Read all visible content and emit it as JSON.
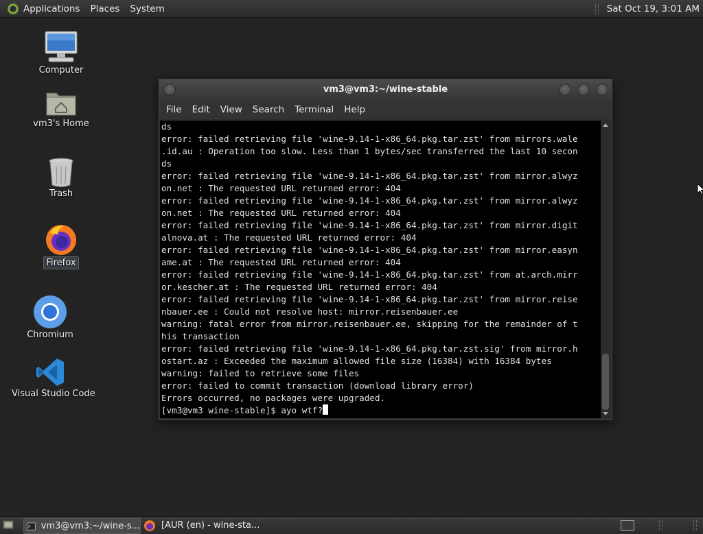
{
  "top_panel": {
    "menus": [
      "Applications",
      "Places",
      "System"
    ],
    "clock": "Sat Oct 19,  3:01 AM"
  },
  "desktop": {
    "icons": [
      {
        "label": "Computer",
        "icon": "computer-icon"
      },
      {
        "label": "vm3's Home",
        "icon": "home-folder-icon"
      },
      {
        "label": "Trash",
        "icon": "trash-icon"
      },
      {
        "label": "Firefox",
        "icon": "firefox-icon"
      },
      {
        "label": "Chromium",
        "icon": "chromium-icon"
      },
      {
        "label": "Visual Studio Code",
        "icon": "vscode-icon"
      }
    ]
  },
  "terminal": {
    "title": "vm3@vm3:~/wine-stable",
    "menu": [
      "File",
      "Edit",
      "View",
      "Search",
      "Terminal",
      "Help"
    ],
    "lines": [
      "ds",
      "error: failed retrieving file 'wine-9.14-1-x86_64.pkg.tar.zst' from mirrors.wale",
      ".id.au : Operation too slow. Less than 1 bytes/sec transferred the last 10 secon",
      "ds",
      "error: failed retrieving file 'wine-9.14-1-x86_64.pkg.tar.zst' from mirror.alwyz",
      "on.net : The requested URL returned error: 404",
      "error: failed retrieving file 'wine-9.14-1-x86_64.pkg.tar.zst' from mirror.alwyz",
      "on.net : The requested URL returned error: 404",
      "error: failed retrieving file 'wine-9.14-1-x86_64.pkg.tar.zst' from mirror.digit",
      "alnova.at : The requested URL returned error: 404",
      "error: failed retrieving file 'wine-9.14-1-x86_64.pkg.tar.zst' from mirror.easyn",
      "ame.at : The requested URL returned error: 404",
      "error: failed retrieving file 'wine-9.14-1-x86_64.pkg.tar.zst' from at.arch.mirr",
      "or.kescher.at : The requested URL returned error: 404",
      "error: failed retrieving file 'wine-9.14-1-x86_64.pkg.tar.zst' from mirror.reise",
      "nbauer.ee : Could not resolve host: mirror.reisenbauer.ee",
      "warning: fatal error from mirror.reisenbauer.ee, skipping for the remainder of t",
      "his transaction",
      "error: failed retrieving file 'wine-9.14-1-x86_64.pkg.tar.zst.sig' from mirror.h",
      "ostart.az : Exceeded the maximum allowed file size (16384) with 16384 bytes",
      "warning: failed to retrieve some files",
      "error: failed to commit transaction (download library error)",
      "Errors occurred, no packages were upgraded."
    ],
    "prompt": "[vm3@vm3 wine-stable]$ ayo wtf?"
  },
  "taskbar": {
    "tasks": [
      {
        "label": "vm3@vm3:~/wine-s...",
        "icon": "terminal-icon",
        "active": true
      },
      {
        "label": "[AUR (en) - wine-sta...",
        "icon": "firefox-icon",
        "active": false
      }
    ]
  }
}
